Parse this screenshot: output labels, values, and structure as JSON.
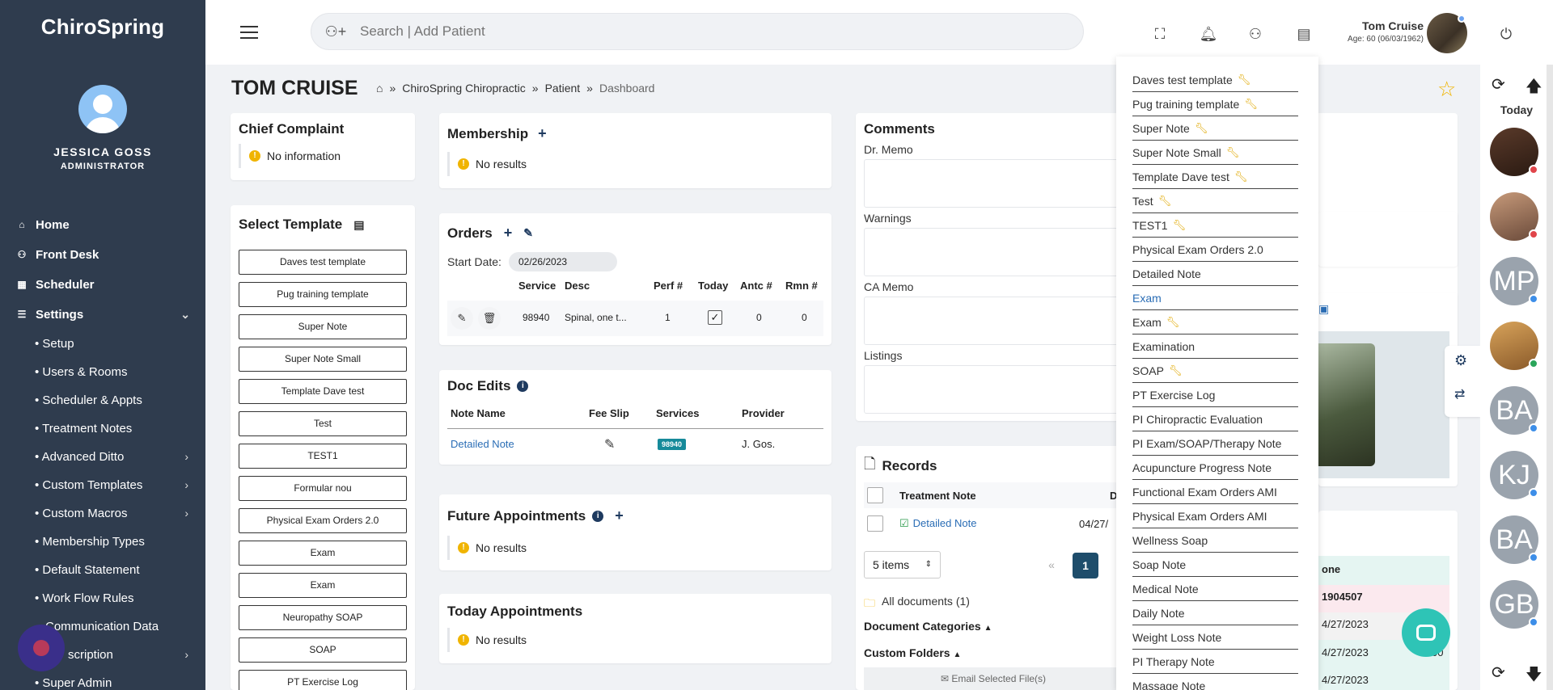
{
  "brand": {
    "logo_text": "ChiroSpring"
  },
  "user": {
    "name": "JESSICA GOSS",
    "role": "ADMINISTRATOR"
  },
  "sidebar": {
    "main_items": [
      {
        "label": "Home",
        "icon": "home-icon"
      },
      {
        "label": "Front Desk",
        "icon": "user-desk-icon"
      },
      {
        "label": "Scheduler",
        "icon": "calendar-icon"
      },
      {
        "label": "Settings",
        "icon": "sliders-icon"
      }
    ],
    "settings_items": [
      {
        "label": "• Setup"
      },
      {
        "label": "• Users & Rooms"
      },
      {
        "label": "• Scheduler & Appts"
      },
      {
        "label": "• Treatment Notes"
      },
      {
        "label": "• Advanced Ditto"
      },
      {
        "label": "• Custom Templates"
      },
      {
        "label": "• Custom Macros"
      },
      {
        "label": "• Membership Types"
      },
      {
        "label": "• Default Statement"
      },
      {
        "label": "• Work Flow Rules"
      },
      {
        "label": "Communication Data"
      },
      {
        "label": "scription"
      },
      {
        "label": "• Super Admin"
      }
    ]
  },
  "header": {
    "search_placeholder": "Search | Add Patient",
    "current_user_name": "Tom Cruise",
    "current_user_age": "Age: 60 (06/03/1962)"
  },
  "patient": {
    "name": "TOM CRUISE",
    "breadcrumb": [
      "ChiroSpring Chiropractic",
      "Patient",
      "Dashboard"
    ]
  },
  "chief_complaint": {
    "title": "Chief Complaint",
    "text": "No information"
  },
  "select_template": {
    "title": "Select Template",
    "templates": [
      "Daves test template",
      "Pug training template",
      "Super Note",
      "Super Note Small",
      "Template Dave test",
      "Test",
      "TEST1",
      "Formular nou",
      "Physical Exam Orders 2.0",
      "Exam",
      "Exam",
      "Neuropathy SOAP",
      "SOAP",
      "PT Exercise Log"
    ]
  },
  "membership": {
    "title": "Membership",
    "text": "No results"
  },
  "orders": {
    "title": "Orders",
    "start_date_label": "Start Date:",
    "start_date": "02/26/2023",
    "columns": [
      "Service",
      "Desc",
      "Perf #",
      "Today",
      "Antc #",
      "Rmn #"
    ],
    "rows": [
      {
        "service": "98940",
        "desc": "Spinal, one t...",
        "perf": "1",
        "antc": "0",
        "rmn": "0"
      }
    ]
  },
  "doc_edits": {
    "title": "Doc Edits",
    "columns": [
      "Note Name",
      "Fee Slip",
      "Services",
      "Provider"
    ],
    "rows": [
      {
        "name": "Detailed Note",
        "service": "98940",
        "provider": "J. Gos."
      }
    ]
  },
  "future_appointments": {
    "title": "Future Appointments",
    "text": "No results"
  },
  "today_appointments": {
    "title": "Today Appointments",
    "text": "No results"
  },
  "comments": {
    "title": "Comments",
    "labels": [
      "Dr. Memo",
      "Warnings",
      "CA Memo",
      "Listings"
    ]
  },
  "records": {
    "title": "Records",
    "col_treatment": "Treatment Note",
    "col_d": "D",
    "row_name": "Detailed Note",
    "row_date": "04/27/",
    "page_size": "5 items",
    "page_prev": "«",
    "page_current": "1",
    "all_documents": "All documents (1)",
    "doc_categories": "Document Categories",
    "custom_folders": "Custom Folders",
    "email_selected": "Email Selected File(s)"
  },
  "partial_table": {
    "col": "one",
    "value": "1904507",
    "dates": [
      "4/27/2023",
      "4/27/2023",
      "4/27/2023"
    ],
    "amount": "00"
  },
  "dropdown": {
    "items": [
      {
        "label": "Daves test template",
        "wrench": true,
        "blue": false
      },
      {
        "label": "Pug training template",
        "wrench": true,
        "blue": false
      },
      {
        "label": "Super Note",
        "wrench": true,
        "blue": false
      },
      {
        "label": "Super Note Small",
        "wrench": true,
        "blue": false
      },
      {
        "label": "Template Dave test",
        "wrench": true,
        "blue": false
      },
      {
        "label": "Test",
        "wrench": true,
        "blue": false
      },
      {
        "label": "TEST1",
        "wrench": true,
        "blue": false
      },
      {
        "label": "Physical Exam Orders 2.0",
        "wrench": false,
        "blue": false
      },
      {
        "label": "Detailed Note",
        "wrench": false,
        "blue": false
      },
      {
        "label": "Exam",
        "wrench": false,
        "blue": true
      },
      {
        "label": "Exam",
        "wrench": true,
        "blue": false
      },
      {
        "label": "Examination",
        "wrench": false,
        "blue": false
      },
      {
        "label": "SOAP",
        "wrench": true,
        "blue": false
      },
      {
        "label": "PT Exercise Log",
        "wrench": false,
        "blue": false
      },
      {
        "label": "PI Chiropractic Evaluation",
        "wrench": false,
        "blue": false
      },
      {
        "label": "PI Exam/SOAP/Therapy Note",
        "wrench": false,
        "blue": false
      },
      {
        "label": "Acupuncture Progress Note",
        "wrench": false,
        "blue": false
      },
      {
        "label": "Functional Exam Orders AMI",
        "wrench": false,
        "blue": false
      },
      {
        "label": "Physical Exam Orders AMI",
        "wrench": false,
        "blue": false
      },
      {
        "label": "Wellness Soap",
        "wrench": false,
        "blue": false
      },
      {
        "label": "Soap Note",
        "wrench": false,
        "blue": false
      },
      {
        "label": "Medical Note",
        "wrench": false,
        "blue": false
      },
      {
        "label": "Daily Note",
        "wrench": false,
        "blue": false
      },
      {
        "label": "Weight Loss Note",
        "wrench": false,
        "blue": false
      },
      {
        "label": "PI Therapy Note",
        "wrench": false,
        "blue": false
      },
      {
        "label": "Massage Note",
        "wrench": false,
        "blue": false
      }
    ]
  },
  "rail": {
    "today_label": "Today",
    "avatars": [
      {
        "initials": "",
        "status": "red"
      },
      {
        "initials": "",
        "status": "red"
      },
      {
        "initials": "MP",
        "status": "blue"
      },
      {
        "initials": "",
        "status": "green"
      },
      {
        "initials": "BA",
        "status": "blue"
      },
      {
        "initials": "KJ",
        "status": "blue"
      },
      {
        "initials": "BA",
        "status": "blue"
      },
      {
        "initials": "GB",
        "status": "blue"
      }
    ]
  },
  "colors": {
    "sidebar": "#2f3c4e",
    "accent_blue": "#2a6db5",
    "badge_teal": "#168a9a",
    "star": "#f0b400",
    "chat": "#2ec4b6"
  }
}
